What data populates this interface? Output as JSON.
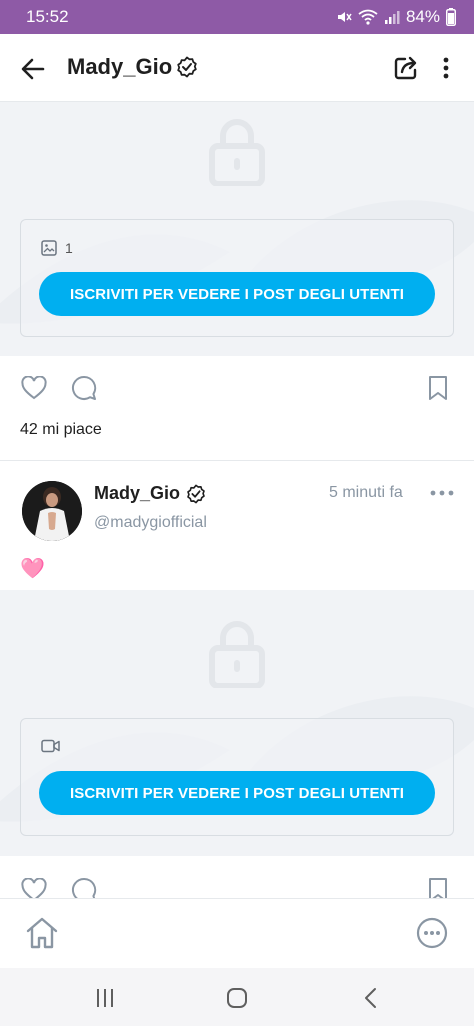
{
  "status_bar": {
    "time": "15:52",
    "battery": "84%",
    "background_color": "#8e5aa6"
  },
  "header": {
    "title": "Mady_Gio",
    "verified_icon": "verified-badge-icon",
    "back_icon": "arrow-left-icon",
    "share_icon": "share-icon",
    "more_icon": "more-vertical-icon"
  },
  "posts": [
    {
      "locked_media": {
        "media_type_icon": "image-icon",
        "media_count": "1",
        "subscribe_label": "ISCRIVITI PER VEDERE I POST DEGLI UTENTI"
      },
      "likes_label": "42 mi piace"
    },
    {
      "author": {
        "name": "Mady_Gio",
        "handle": "@madygiofficial"
      },
      "time": "5 minuti fa",
      "text": "🩷",
      "locked_media": {
        "media_type_icon": "video-icon",
        "subscribe_label": "ISCRIVITI PER VEDERE I POST DEGLI UTENTI"
      }
    }
  ],
  "colors": {
    "accent": "#00aff0",
    "muted_text": "#8a96a3",
    "icon_gray": "#8a96a3"
  },
  "bottom_nav": {
    "home_icon": "home-icon",
    "menu_icon": "more-horizontal-circle-icon"
  },
  "system_nav": {
    "recents_icon": "recents-icon",
    "home_icon": "system-home-icon",
    "back_icon": "system-back-icon"
  }
}
